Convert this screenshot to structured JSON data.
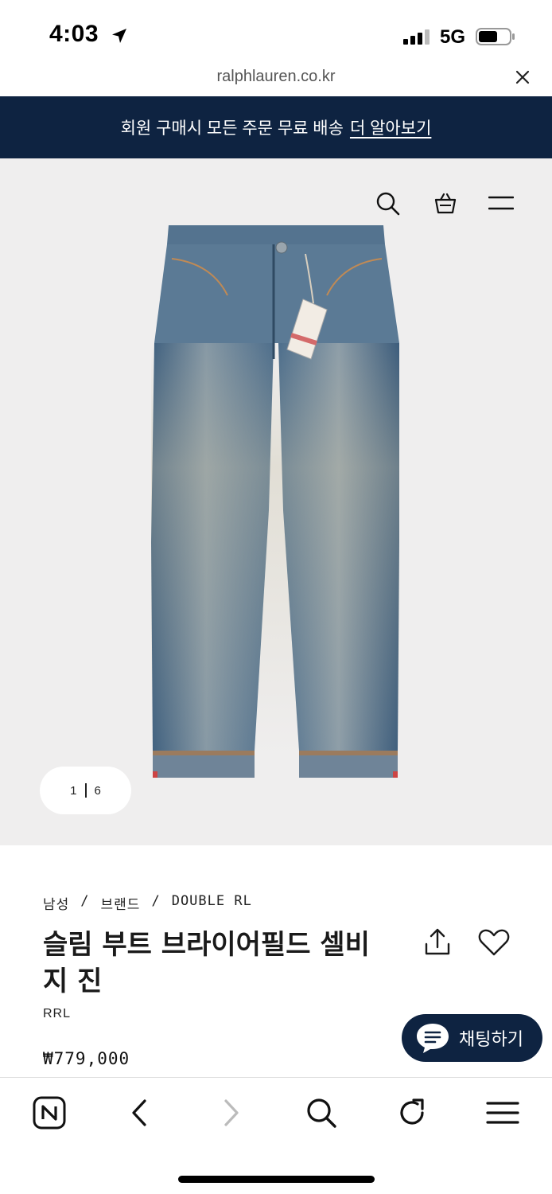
{
  "status_bar": {
    "time": "4:03",
    "network": "5G"
  },
  "url_bar": {
    "domain": "ralphlauren.co.kr"
  },
  "promo": {
    "text": "회원 구매시 모든 주문 무료 배송",
    "link": "더 알아보기"
  },
  "gallery": {
    "current": "1",
    "total": "6",
    "tag_text": "DOUBLE RL"
  },
  "product": {
    "breadcrumb": [
      "남성",
      "/",
      "브랜드",
      "/",
      "DOUBLE RL"
    ],
    "title": "슬림 부트 브라이어필드 셀비지 진",
    "brand": "RRL",
    "price": "₩779,000"
  },
  "chat": {
    "label": "채팅하기"
  },
  "colors": {
    "navy": "#0e2341",
    "hero_bg": "#efeeee",
    "denim": "#4d6e8c"
  },
  "icons": [
    "location-arrow-icon",
    "signal-icon",
    "battery-icon",
    "close-icon",
    "search-icon",
    "shopping-bag-icon",
    "menu-icon",
    "share-icon",
    "heart-icon",
    "chat-icon",
    "naver-home-icon",
    "back-icon",
    "forward-icon",
    "refresh-icon"
  ]
}
